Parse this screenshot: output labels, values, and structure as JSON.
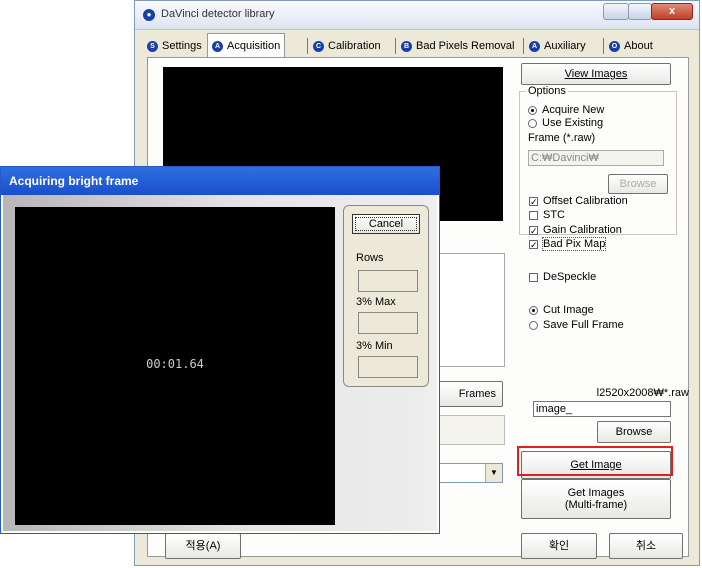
{
  "window": {
    "title": "DaVinci detector library",
    "close_glyph": "x"
  },
  "tabs": [
    {
      "label": "Settings",
      "icon": "S"
    },
    {
      "label": "Acquisition",
      "icon": "A"
    },
    {
      "label": "Calibration",
      "icon": "C"
    },
    {
      "label": "Bad Pixels Removal",
      "icon": "B"
    },
    {
      "label": "Auxiliary",
      "icon": "A"
    },
    {
      "label": "About",
      "icon": "O"
    }
  ],
  "right_panel": {
    "view_images": "View Images",
    "options_legend": "Options",
    "acquire_new": "Acquire New",
    "use_existing": "Use Existing",
    "frame_label": "Frame (*.raw)",
    "frame_path": "C:₩Davinci₩",
    "browse_disabled": "Browse",
    "offset_calibration": "Offset Calibration",
    "stc": "STC",
    "gain_calibration": "Gain Calibration",
    "bad_pix_map": "Bad Pix Map",
    "despeckle": "DeSpeckle",
    "cut_image": "Cut Image",
    "save_full_frame": "Save Full Frame",
    "size_label": "l2520x2008₩*.raw",
    "image_name": "image_",
    "browse": "Browse",
    "get_image": "Get Image",
    "get_images_line1": "Get Images",
    "get_images_line2": "(Multi-frame)",
    "ok": "확인",
    "cancel": "취소",
    "apply": "적용(A)"
  },
  "left_panel": {
    "frames_button": "Frames"
  },
  "dialog": {
    "title": "Acquiring bright frame",
    "timer": "00:01.64",
    "cancel": "Cancel",
    "rows_label": "Rows",
    "max_label": "3% Max",
    "min_label": "3% Min"
  },
  "colors": {
    "highlight": "#e02020",
    "dialog_title": "#1a4fcb"
  }
}
